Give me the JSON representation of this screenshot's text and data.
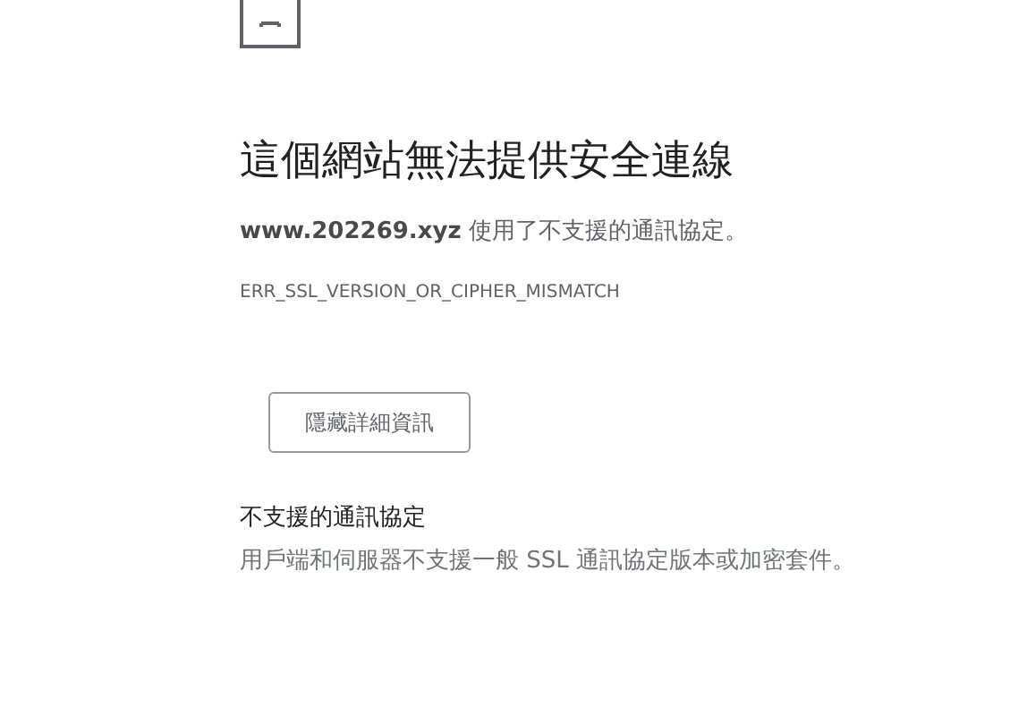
{
  "heading": "這個網站無法提供安全連線",
  "summary": "**www.202269.xyz** 使用了不支援的通訊協定。",
  "error_code": "ERR_SSL_VERSION_OR_CIPHER_MISMATCH",
  "details_button": "隱藏詳細資訊",
  "details": {
    "title": "不支援的通訊協定",
    "description": "用戶端和伺服器不支援一般 SSL 通訊協定版本或加密套件。"
  }
}
